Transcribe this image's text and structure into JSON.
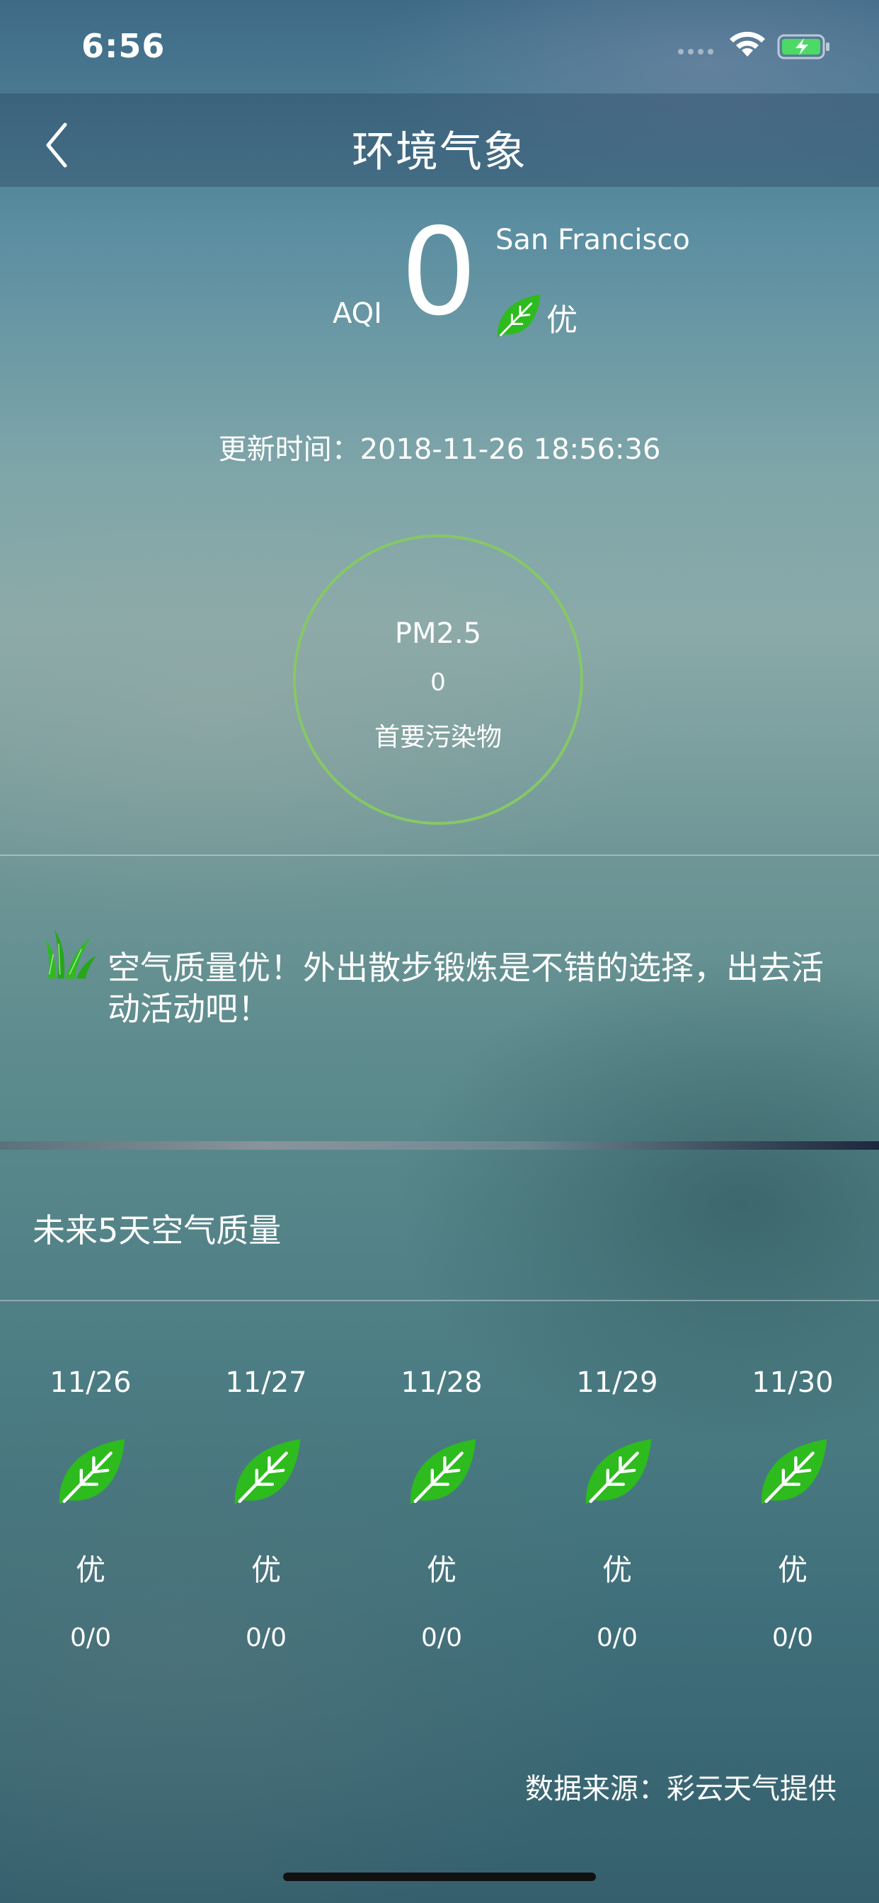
{
  "status_bar": {
    "time": "6:56"
  },
  "nav": {
    "title": "环境气象"
  },
  "aqi": {
    "label": "AQI",
    "value": "0",
    "city": "San Francisco",
    "level": "优",
    "updated": "更新时间：2018-11-26 18:56:36"
  },
  "pollutant": {
    "name": "PM2.5",
    "value": "0",
    "desc": "首要污染物"
  },
  "advice": {
    "text": "空气质量优！外出散步锻炼是不错的选择，出去活动活动吧！"
  },
  "forecast": {
    "title": "未来5天空气质量",
    "days": [
      {
        "date": "11/26",
        "level": "优",
        "value": "0/0"
      },
      {
        "date": "11/27",
        "level": "优",
        "value": "0/0"
      },
      {
        "date": "11/28",
        "level": "优",
        "value": "0/0"
      },
      {
        "date": "11/29",
        "level": "优",
        "value": "0/0"
      },
      {
        "date": "11/30",
        "level": "优",
        "value": "0/0"
      }
    ]
  },
  "source": {
    "text": "数据来源：彩云天气提供"
  },
  "colors": {
    "leaf": "#2dbb1e",
    "ring": "#86c866",
    "battery": "#4cd964"
  },
  "icons": {
    "leaf": "leaf-icon",
    "grass": "grass-icon",
    "back": "chevron-left-icon"
  }
}
